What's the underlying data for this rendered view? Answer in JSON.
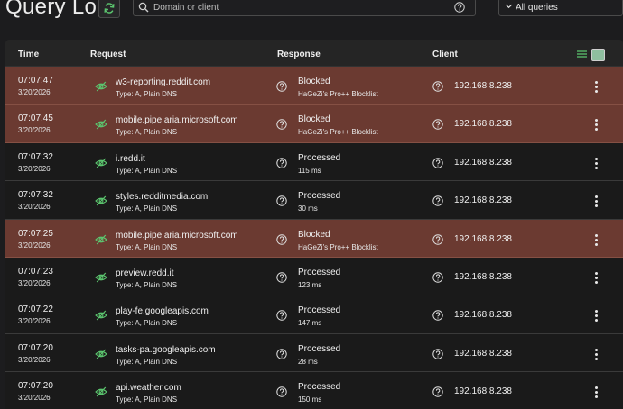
{
  "header": {
    "title": "Query Log",
    "search_placeholder": "Domain or client",
    "filter_value": "All queries"
  },
  "table": {
    "columns": {
      "time": "Time",
      "request": "Request",
      "response": "Response",
      "client": "Client"
    }
  },
  "colors": {
    "blocked_row": "#6b3a31",
    "accent_green": "#5cc66f"
  },
  "rows": [
    {
      "time": "07:07:47",
      "date": "3/20/2026",
      "domain": "w3-reporting.reddit.com",
      "type": "Type: A, Plain DNS",
      "status": "Blocked",
      "detail": "HaGeZi's Pro++ Blocklist",
      "client": "192.168.8.238",
      "state": "blocked"
    },
    {
      "time": "07:07:45",
      "date": "3/20/2026",
      "domain": "mobile.pipe.aria.microsoft.com",
      "type": "Type: A, Plain DNS",
      "status": "Blocked",
      "detail": "HaGeZi's Pro++ Blocklist",
      "client": "192.168.8.238",
      "state": "blocked"
    },
    {
      "time": "07:07:32",
      "date": "3/20/2026",
      "domain": "i.redd.it",
      "type": "Type: A, Plain DNS",
      "status": "Processed",
      "detail": "115 ms",
      "client": "192.168.8.238",
      "state": "processed"
    },
    {
      "time": "07:07:32",
      "date": "3/20/2026",
      "domain": "styles.redditmedia.com",
      "type": "Type: A, Plain DNS",
      "status": "Processed",
      "detail": "30 ms",
      "client": "192.168.8.238",
      "state": "processed"
    },
    {
      "time": "07:07:25",
      "date": "3/20/2026",
      "domain": "mobile.pipe.aria.microsoft.com",
      "type": "Type: A, Plain DNS",
      "status": "Blocked",
      "detail": "HaGeZi's Pro++ Blocklist",
      "client": "192.168.8.238",
      "state": "blocked"
    },
    {
      "time": "07:07:23",
      "date": "3/20/2026",
      "domain": "preview.redd.it",
      "type": "Type: A, Plain DNS",
      "status": "Processed",
      "detail": "123 ms",
      "client": "192.168.8.238",
      "state": "processed"
    },
    {
      "time": "07:07:22",
      "date": "3/20/2026",
      "domain": "play-fe.googleapis.com",
      "type": "Type: A, Plain DNS",
      "status": "Processed",
      "detail": "147 ms",
      "client": "192.168.8.238",
      "state": "processed"
    },
    {
      "time": "07:07:20",
      "date": "3/20/2026",
      "domain": "tasks-pa.googleapis.com",
      "type": "Type: A, Plain DNS",
      "status": "Processed",
      "detail": "28 ms",
      "client": "192.168.8.238",
      "state": "processed"
    },
    {
      "time": "07:07:20",
      "date": "3/20/2026",
      "domain": "api.weather.com",
      "type": "Type: A, Plain DNS",
      "status": "Processed",
      "detail": "150 ms",
      "client": "192.168.8.238",
      "state": "processed"
    }
  ]
}
